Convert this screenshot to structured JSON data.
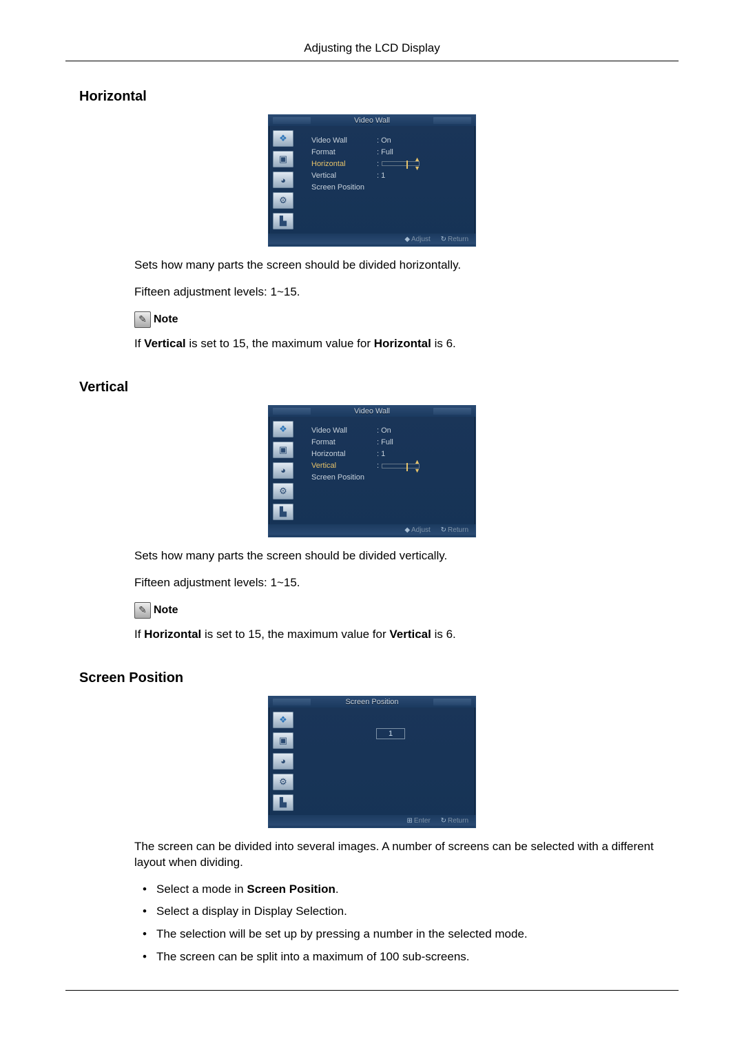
{
  "header": {
    "title": "Adjusting the LCD Display"
  },
  "sections": {
    "horizontal": {
      "heading": "Horizontal",
      "desc": "Sets how many parts the screen should be divided horizontally.",
      "levels": "Fifteen adjustment levels: 1~15.",
      "note_label": "Note",
      "note_pre": "If ",
      "note_b1": "Vertical",
      "note_mid": " is set to 15, the maximum value for ",
      "note_b2": "Horizontal",
      "note_post": " is 6."
    },
    "vertical": {
      "heading": "Vertical",
      "desc": "Sets how many parts the screen should be divided vertically.",
      "levels": "Fifteen adjustment levels: 1~15.",
      "note_label": "Note",
      "note_pre": "If ",
      "note_b1": "Horizontal",
      "note_mid": " is set to 15, the maximum value for ",
      "note_b2": "Vertical",
      "note_post": " is 6."
    },
    "screen_position": {
      "heading": "Screen Position",
      "desc": "The screen can be divided into several images. A number of screens can be selected with a different layout when dividing.",
      "bullets": {
        "b1_pre": "Select a mode in ",
        "b1_b": "Screen Position",
        "b1_post": ".",
        "b2": "Select a display in Display Selection.",
        "b3": "The selection will be set up by pressing a number in the selected mode.",
        "b4": "The screen can be split into a maximum of 100 sub-screens."
      }
    }
  },
  "osd_common": {
    "foot_adjust": "Adjust",
    "foot_return": "Return",
    "foot_enter": "Enter"
  },
  "osd1": {
    "title": "Video Wall",
    "rows": {
      "r1_label": "Video Wall",
      "r1_val": ": On",
      "r2_label": "Format",
      "r2_val": ": Full",
      "r3_label": "Horizontal",
      "r3_val": ":",
      "r4_label": "Vertical",
      "r4_val": ": 1",
      "r5_label": "Screen Position"
    }
  },
  "osd2": {
    "title": "Video Wall",
    "rows": {
      "r1_label": "Video Wall",
      "r1_val": ": On",
      "r2_label": "Format",
      "r2_val": ": Full",
      "r3_label": "Horizontal",
      "r3_val": ": 1",
      "r4_label": "Vertical",
      "r4_val": ":",
      "r5_label": "Screen Position"
    }
  },
  "osd3": {
    "title": "Screen Position",
    "value": "1"
  }
}
